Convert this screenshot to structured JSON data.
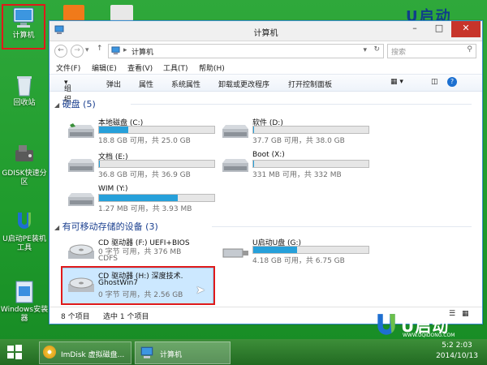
{
  "desktop": {
    "icons": [
      {
        "label": "计算机"
      },
      {
        "label": "回收站"
      },
      {
        "label": "GDISK快速分区"
      },
      {
        "label": "U启动PE装机工具"
      },
      {
        "label": "Windows安装器"
      }
    ],
    "brand_top": "U启动",
    "brand_bottom": "U启动",
    "brand_url": "WWW.UQIDONG.COM"
  },
  "window": {
    "title": "计算机",
    "address": {
      "path": "计算机",
      "search_placeholder": "搜索"
    },
    "menu": [
      "文件(F)",
      "编辑(E)",
      "查看(V)",
      "工具(T)",
      "帮助(H)"
    ],
    "commands": [
      "组织",
      "弹出",
      "属性",
      "系统属性",
      "卸载或更改程序",
      "打开控制面板"
    ],
    "groups": {
      "hdd": "硬盘 (5)",
      "removable": "有可移动存储的设备 (3)"
    },
    "drives": [
      {
        "name": "本地磁盘 (C:)",
        "info": "18.8 GB 可用，共 25.0 GB",
        "used_fraction": 0.25
      },
      {
        "name": "软件 (D:)",
        "info": "37.7 GB 可用，共 38.0 GB",
        "used_fraction": 0.01
      },
      {
        "name": "文档 (E:)",
        "info": "36.8 GB 可用，共 36.9 GB",
        "used_fraction": 0.01
      },
      {
        "name": "Boot (X:)",
        "info": "331 MB 可用，共 332 MB",
        "used_fraction": 0.01
      },
      {
        "name": "WIM (Y:)",
        "info": "1.27 MB 可用，共 3.93 MB",
        "used_fraction": 0.68
      }
    ],
    "removable": [
      {
        "name": "CD 驱动器 (F:) UEFI+BIOS",
        "info": "0 字节 可用，共 376 MB",
        "extra": "CDFS"
      },
      {
        "name": "U启动U盘 (G:)",
        "info": "4.18 GB 可用，共 6.75 GB",
        "used_fraction": 0.38
      },
      {
        "name": "CD 驱动器 (H:) 深度技术.",
        "name2": "GhostWin7",
        "info": "0 字节 可用，共 2.56 GB"
      }
    ],
    "status": {
      "count": "8 个项目",
      "selected": "选中 1 个项目"
    }
  },
  "taskbar": {
    "items": [
      {
        "label": "ImDisk 虚拟磁盘..."
      },
      {
        "label": "计算机"
      }
    ],
    "clock_time": "5:2 2:03",
    "clock_date": "2014/10/13"
  },
  "colors": {
    "desktop_green": "#2fa83b",
    "selection_red": "#e01a1a",
    "usage_blue": "#26a0da"
  }
}
